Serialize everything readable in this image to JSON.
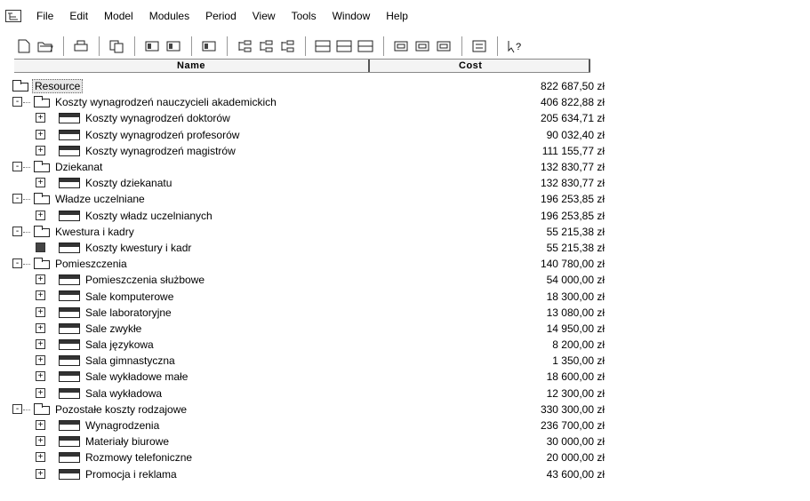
{
  "menu": {
    "items": [
      "File",
      "Edit",
      "Model",
      "Modules",
      "Period",
      "View",
      "Tools",
      "Window",
      "Help"
    ]
  },
  "toolbar": {
    "icons": [
      "new-document-icon",
      "open-folder-icon",
      "print-icon",
      "copy-icon",
      "link-resource-icon",
      "unlink-resource-icon",
      "card-icon",
      "tree-expand-icon",
      "list-icon",
      "tree-collapse-icon",
      "grid-icon",
      "split-view-icon",
      "monitor-icon",
      "calc-1-icon",
      "calc-2-icon",
      "calc-3-icon",
      "report-icon",
      "help-icon"
    ]
  },
  "columns": {
    "name": "Name",
    "cost": "Cost"
  },
  "rows": [
    {
      "name": "Resource",
      "cost": "822 687,50 zł",
      "level": 0,
      "type": "root",
      "selected": true
    },
    {
      "name": "Koszty wynagrodzeń nauczycieli akademickich",
      "cost": "406 822,88 zł",
      "level": 1,
      "type": "folder",
      "expander": "-"
    },
    {
      "name": "Koszty wynagrodzeń doktorów",
      "cost": "205 634,71 zł",
      "level": 2,
      "type": "resource",
      "expander": "+"
    },
    {
      "name": "Koszty wynagrodzeń profesorów",
      "cost": "90 032,40 zł",
      "level": 2,
      "type": "resource",
      "expander": "+"
    },
    {
      "name": "Koszty wynagrodzeń magistrów",
      "cost": "111 155,77 zł",
      "level": 2,
      "type": "resource",
      "expander": "+"
    },
    {
      "name": "Dziekanat",
      "cost": "132 830,77 zł",
      "level": 1,
      "type": "folder",
      "expander": "-"
    },
    {
      "name": "Koszty dziekanatu",
      "cost": "132 830,77 zł",
      "level": 2,
      "type": "resource",
      "expander": "+"
    },
    {
      "name": "Władze uczelniane",
      "cost": "196 253,85 zł",
      "level": 1,
      "type": "folder",
      "expander": "-"
    },
    {
      "name": "Koszty władz uczelnianych",
      "cost": "196 253,85 zł",
      "level": 2,
      "type": "resource",
      "expander": "+"
    },
    {
      "name": "Kwestura i kadry",
      "cost": "55 215,38 zł",
      "level": 1,
      "type": "folder",
      "expander": "-"
    },
    {
      "name": "Koszty kwestury i kadr",
      "cost": "55 215,38 zł",
      "level": 2,
      "type": "resource",
      "expander": "+",
      "filled": true
    },
    {
      "name": "Pomieszczenia",
      "cost": "140 780,00 zł",
      "level": 1,
      "type": "folder",
      "expander": "-"
    },
    {
      "name": "Pomieszczenia służbowe",
      "cost": "54 000,00 zł",
      "level": 2,
      "type": "resource",
      "expander": "+"
    },
    {
      "name": "Sale komputerowe",
      "cost": "18 300,00 zł",
      "level": 2,
      "type": "resource",
      "expander": "+"
    },
    {
      "name": "Sale laboratoryjne",
      "cost": "13 080,00 zł",
      "level": 2,
      "type": "resource",
      "expander": "+"
    },
    {
      "name": "Sale zwykłe",
      "cost": "14 950,00 zł",
      "level": 2,
      "type": "resource",
      "expander": "+"
    },
    {
      "name": "Sala językowa",
      "cost": "8 200,00 zł",
      "level": 2,
      "type": "resource",
      "expander": "+"
    },
    {
      "name": "Sala gimnastyczna",
      "cost": "1 350,00 zł",
      "level": 2,
      "type": "resource",
      "expander": "+"
    },
    {
      "name": "Sale wykładowe małe",
      "cost": "18 600,00 zł",
      "level": 2,
      "type": "resource",
      "expander": "+"
    },
    {
      "name": "Sala wykładowa",
      "cost": "12 300,00 zł",
      "level": 2,
      "type": "resource",
      "expander": "+"
    },
    {
      "name": "Pozostałe koszty rodzajowe",
      "cost": "330 300,00 zł",
      "level": 1,
      "type": "folder",
      "expander": "-"
    },
    {
      "name": "Wynagrodzenia",
      "cost": "236 700,00 zł",
      "level": 2,
      "type": "resource",
      "expander": "+"
    },
    {
      "name": "Materiały biurowe",
      "cost": "30 000,00 zł",
      "level": 2,
      "type": "resource",
      "expander": "+"
    },
    {
      "name": "Rozmowy telefoniczne",
      "cost": "20 000,00 zł",
      "level": 2,
      "type": "resource",
      "expander": "+"
    },
    {
      "name": "Promocja i reklama",
      "cost": "43 600,00 zł",
      "level": 2,
      "type": "resource",
      "expander": "+"
    }
  ]
}
